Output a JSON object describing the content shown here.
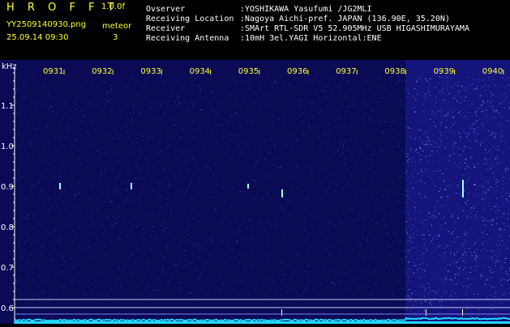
{
  "header": {
    "brand": "H R O F F T",
    "version": "1.0.0f",
    "filename": "YY2509140930.png",
    "datetime": "25.09.14 09:30",
    "meteor_label": "meteor",
    "meteor_count": "3",
    "info_labels": [
      "Ovserver",
      "Receiving Location",
      "Receiver",
      "Receiving Antenna"
    ],
    "info_values": [
      ":YOSHIKAWA Yasufumi /JG2MLI",
      ":Nagoya Aichi-pref. JAPAN (136.90E, 35.20N)",
      ":SMArt RTL-SDR V5 52.905MHz USB HIGASHIMURAYAMA",
      ":10mH 3el.YAGI Horizontal:ENE"
    ]
  },
  "spectrogram": {
    "y_unit": "kHz",
    "y_ticks": [
      "1.1",
      "1.0",
      "0.9",
      "0.8",
      "0.7",
      "0.6"
    ],
    "time_labels": [
      "0931",
      "0932",
      "0933",
      "0934",
      "0935",
      "0936",
      "0937",
      "0938",
      "0939",
      "0940"
    ],
    "colors": {
      "background": "#0a0a55",
      "noise": "#4a5cff",
      "label": "#ffff33",
      "axis": "#ffffff",
      "baseline": "#22d8ff",
      "meteor": "#9affff"
    }
  }
}
